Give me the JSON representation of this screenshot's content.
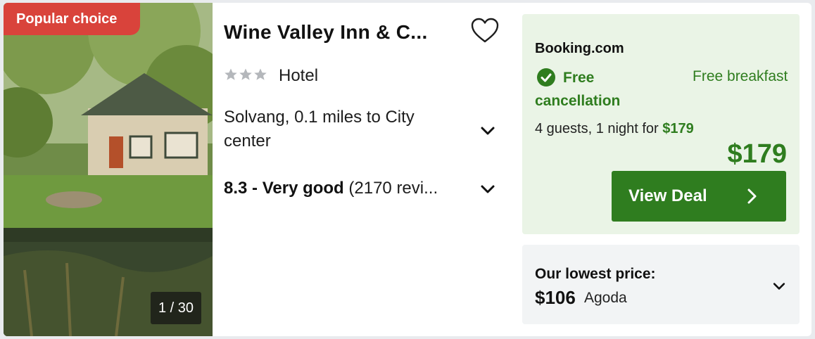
{
  "badge": "Popular choice",
  "photo": {
    "counter": "1 / 30"
  },
  "hotel": {
    "name": "Wine Valley Inn & C...",
    "stars": 3,
    "type": "Hotel",
    "location": "Solvang, 0.1 miles to City center",
    "rating_score": "8.3 - Very good",
    "rating_reviews": "(2170 revi..."
  },
  "deal": {
    "provider": "Booking.com",
    "free_cancellation": "Free cancellation",
    "free_breakfast": "Free breakfast",
    "guests_text": "4 guests, 1 night for ",
    "guests_price": "$179",
    "price": "$179",
    "button_label": "View Deal"
  },
  "lowest": {
    "label": "Our lowest price:",
    "price": "$106",
    "agent": "Agoda"
  },
  "colors": {
    "badge": "#d9433b",
    "accent_green": "#2f7d1f",
    "deal_bg": "#eaf4e6",
    "lowest_bg": "#f2f4f5",
    "star": "#b4b7bb"
  },
  "icons": [
    "heart-icon",
    "star-icon",
    "chevron-down-icon",
    "check-circle-icon",
    "chevron-right-icon"
  ]
}
